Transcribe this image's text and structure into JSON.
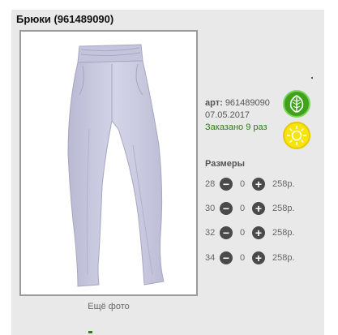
{
  "product": {
    "title": "Брюки (961489090)",
    "more_photos": "Ещё фото"
  },
  "info": {
    "sku_label": "арт:",
    "sku_value": "961489090",
    "date": "07.05.2017",
    "ordered": "Заказано 9 раз"
  },
  "sizes": {
    "title": "Размеры",
    "rows": [
      {
        "size": "28",
        "minus": "−",
        "qty": "0",
        "plus": "+",
        "price": "258р."
      },
      {
        "size": "30",
        "minus": "−",
        "qty": "0",
        "plus": "+",
        "price": "258р."
      },
      {
        "size": "32",
        "minus": "−",
        "qty": "0",
        "plus": "+",
        "price": "258р."
      },
      {
        "size": "34",
        "minus": "−",
        "qty": "0",
        "plus": "+",
        "price": "258р."
      }
    ]
  },
  "icons": {
    "leaf": "leaf-icon",
    "sun": "sun-icon"
  },
  "colors": {
    "card_bg": "#e9e9e9",
    "ordered_green": "#2e7d15",
    "leaf_badge": "#3fa21a",
    "sun_badge": "#f6e40a",
    "pants": "#c9c9e0"
  }
}
